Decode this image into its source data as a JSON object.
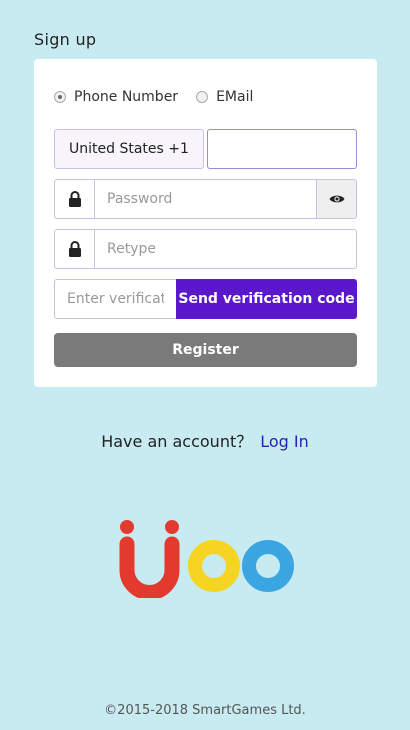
{
  "header": {
    "title": "Sign up"
  },
  "form": {
    "radio_options": [
      {
        "label": "Phone Number",
        "checked": true
      },
      {
        "label": "EMail",
        "checked": false
      }
    ],
    "country_value": "United States +1",
    "phone_value": "",
    "password_placeholder": "Password",
    "retype_placeholder": "Retype",
    "verify_placeholder": "Enter verification code",
    "send_code_label": "Send verification code",
    "register_label": "Register"
  },
  "account": {
    "prompt": "Have an account？",
    "login_label": "Log In"
  },
  "logo": {
    "colors": {
      "u": "#e23a2e",
      "o1": "#f5d422",
      "o2": "#3aa5e0"
    }
  },
  "footer": {
    "copyright": "©2015-2018 SmartGames Ltd."
  },
  "colors": {
    "accent": "#5a17cc",
    "background": "#c8ebf2",
    "register": "#7a7a7a"
  }
}
